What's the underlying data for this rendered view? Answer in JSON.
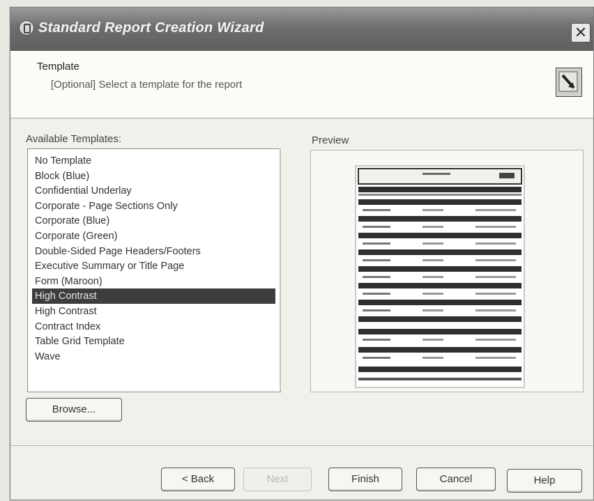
{
  "window": {
    "title": "Standard Report Creation Wizard",
    "close_glyph": "✕"
  },
  "header": {
    "title": "Template",
    "description": "[Optional] Select a template for the report"
  },
  "templates": {
    "label": "Available Templates:",
    "items": [
      "No Template",
      "Block (Blue)",
      "Confidential Underlay",
      "Corporate - Page Sections Only",
      "Corporate (Blue)",
      "Corporate (Green)",
      "Double-Sided Page Headers/Footers",
      "Executive Summary or Title Page",
      "Form (Maroon)",
      "High Contrast",
      "High Contrast",
      "Contract Index",
      "Table Grid Template",
      "Wave"
    ],
    "selected_index": 9
  },
  "preview": {
    "label": "Preview"
  },
  "buttons": {
    "browse": "Browse...",
    "back": "< Back",
    "next": "Next",
    "finish": "Finish",
    "cancel": "Cancel",
    "help": "Help"
  }
}
